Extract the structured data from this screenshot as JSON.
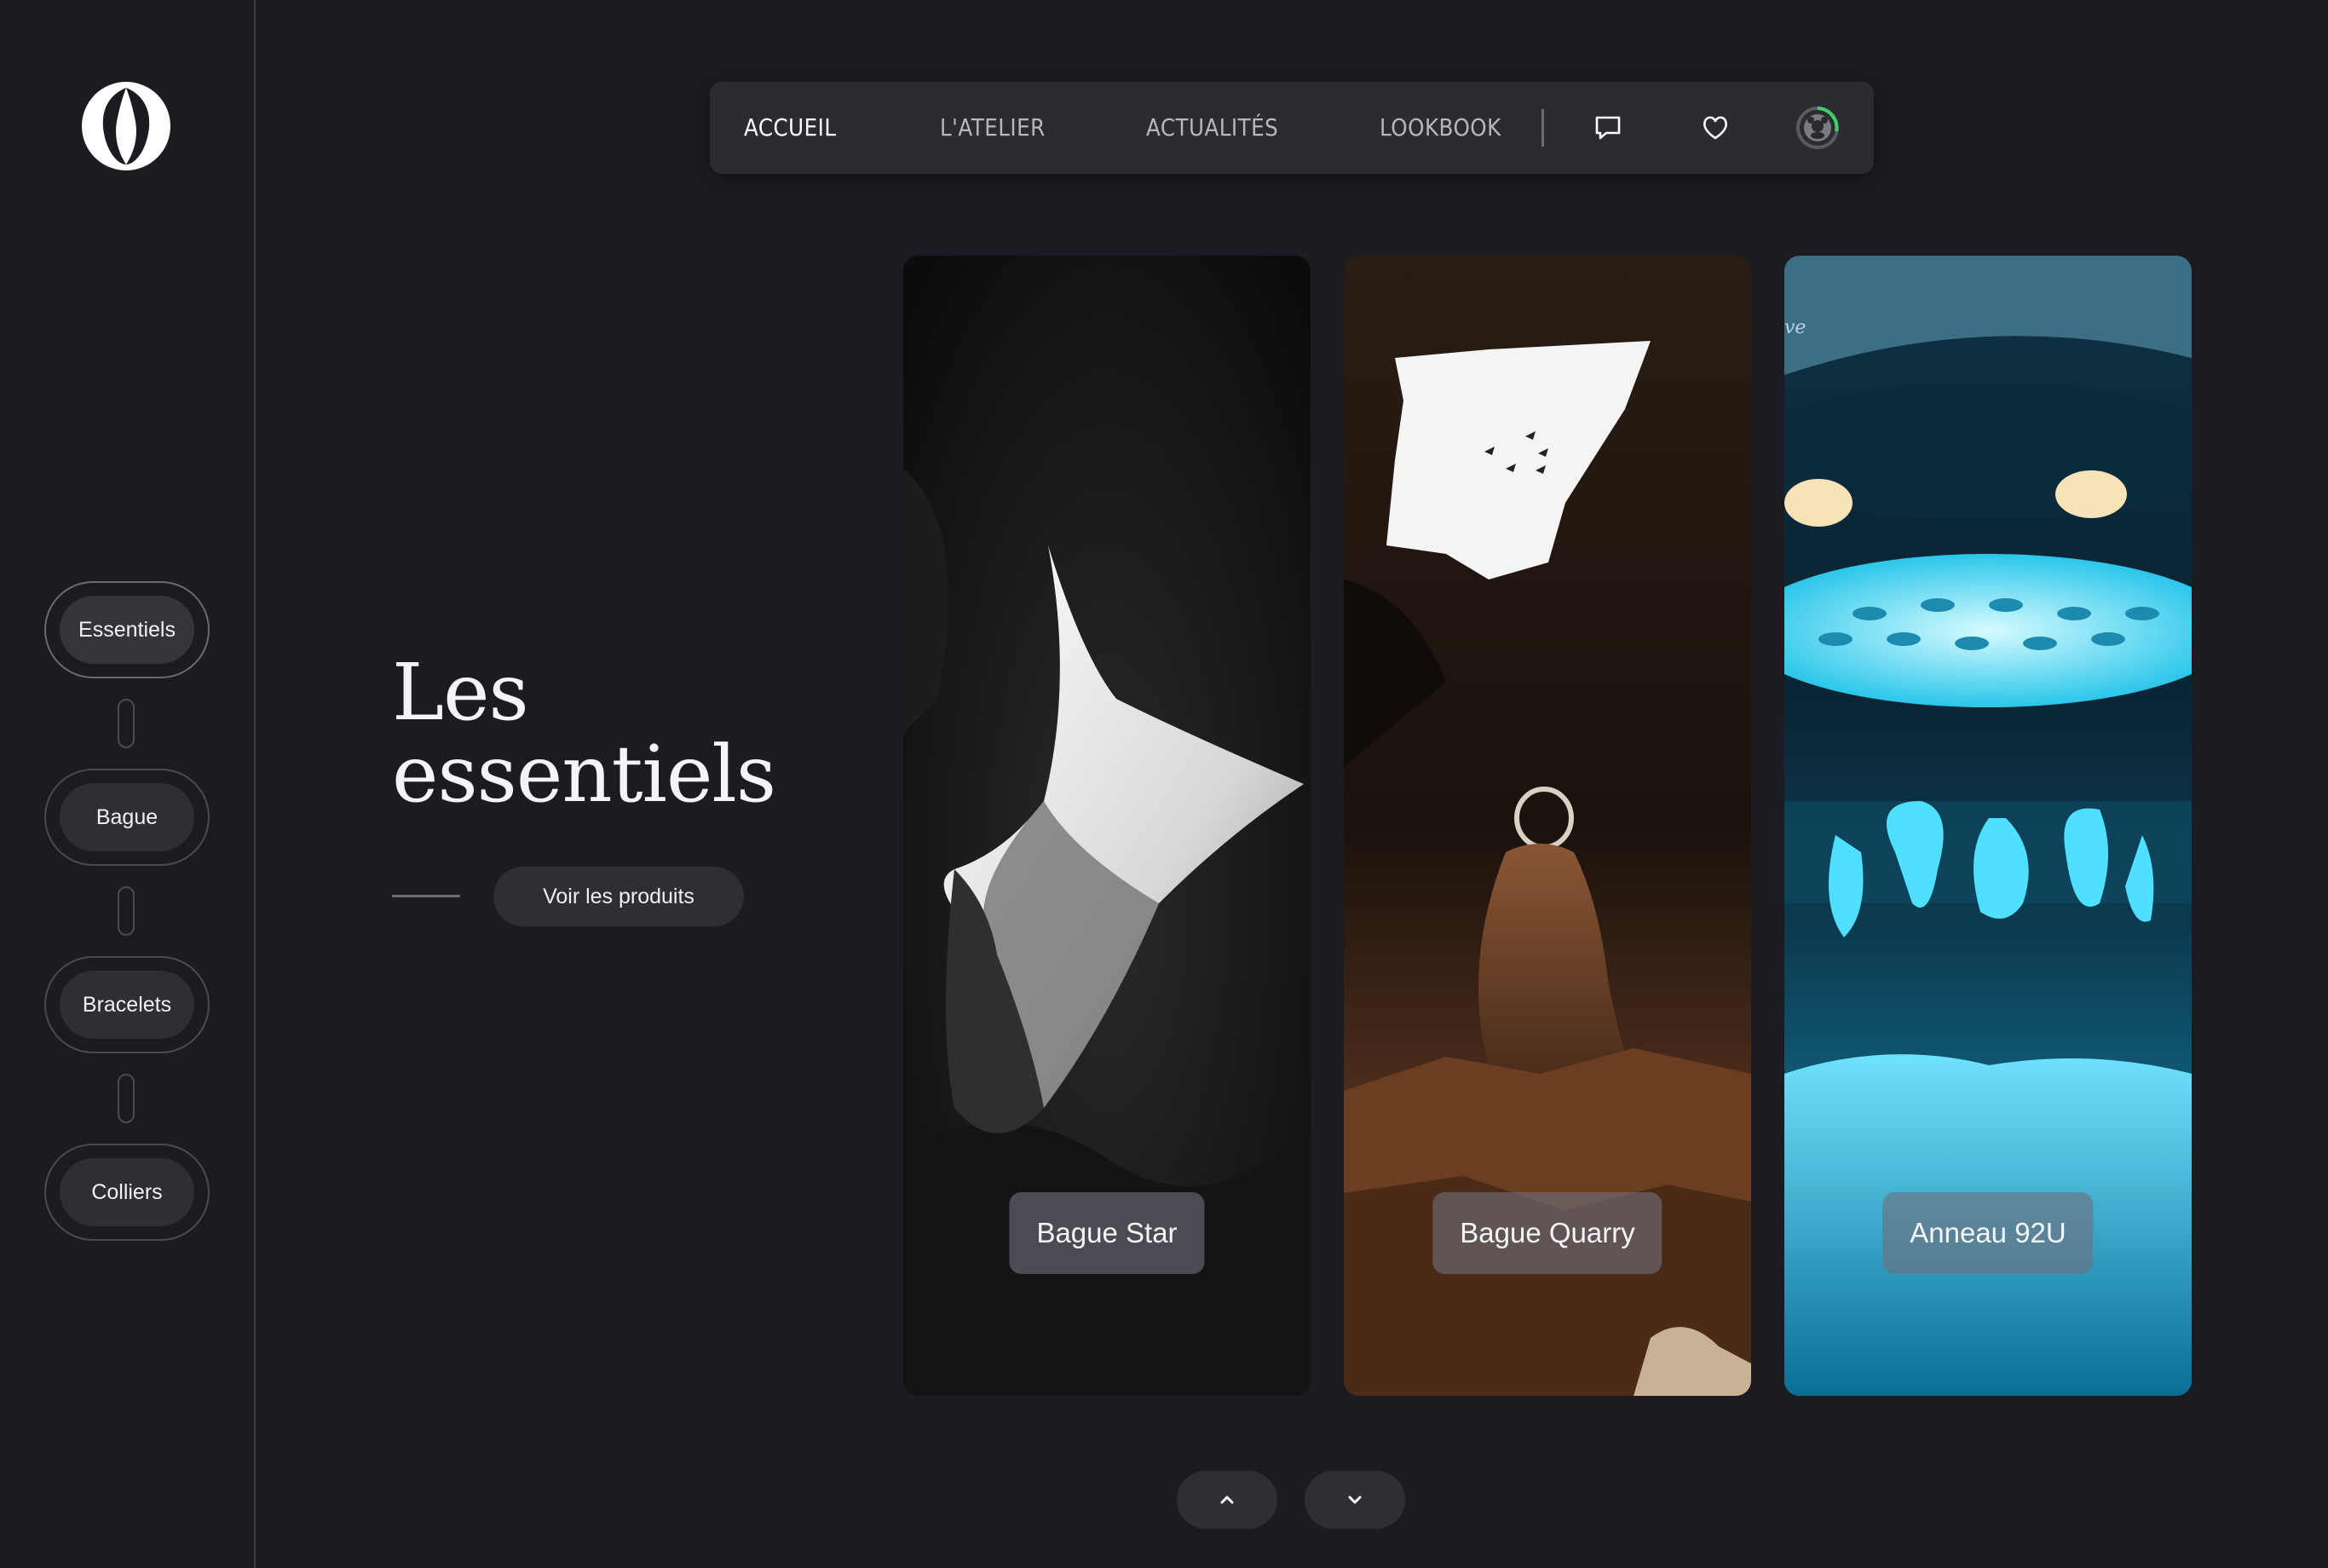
{
  "nav": {
    "items": [
      "ACCUEIL",
      "L'ATELIER",
      "ACTUALITÉS",
      "LOOKBOOK"
    ],
    "active_index": 0,
    "icons": [
      "chat-bubble-icon",
      "heart-icon",
      "avatar-icon"
    ]
  },
  "sidebar": {
    "logo": "ring-logo-icon",
    "categories": [
      "Essentiels",
      "Bague",
      "Bracelets",
      "Colliers"
    ],
    "active_index": 0
  },
  "hero": {
    "title_line1": "Les",
    "title_line2": "essentiels",
    "cta_label": "Voir les produits"
  },
  "cards": [
    {
      "label": "Bague Star"
    },
    {
      "label": "Bague Quarry"
    },
    {
      "label": "Anneau 92U",
      "side_text": "ve"
    }
  ],
  "pagination": {
    "up_icon": "chevron-up-icon",
    "down_icon": "chevron-down-icon"
  },
  "colors": {
    "background": "#1b1c21",
    "nav_background": "#2b2c32",
    "pill_background": "#2e2f35",
    "accent_green": "#3ecf6a"
  }
}
